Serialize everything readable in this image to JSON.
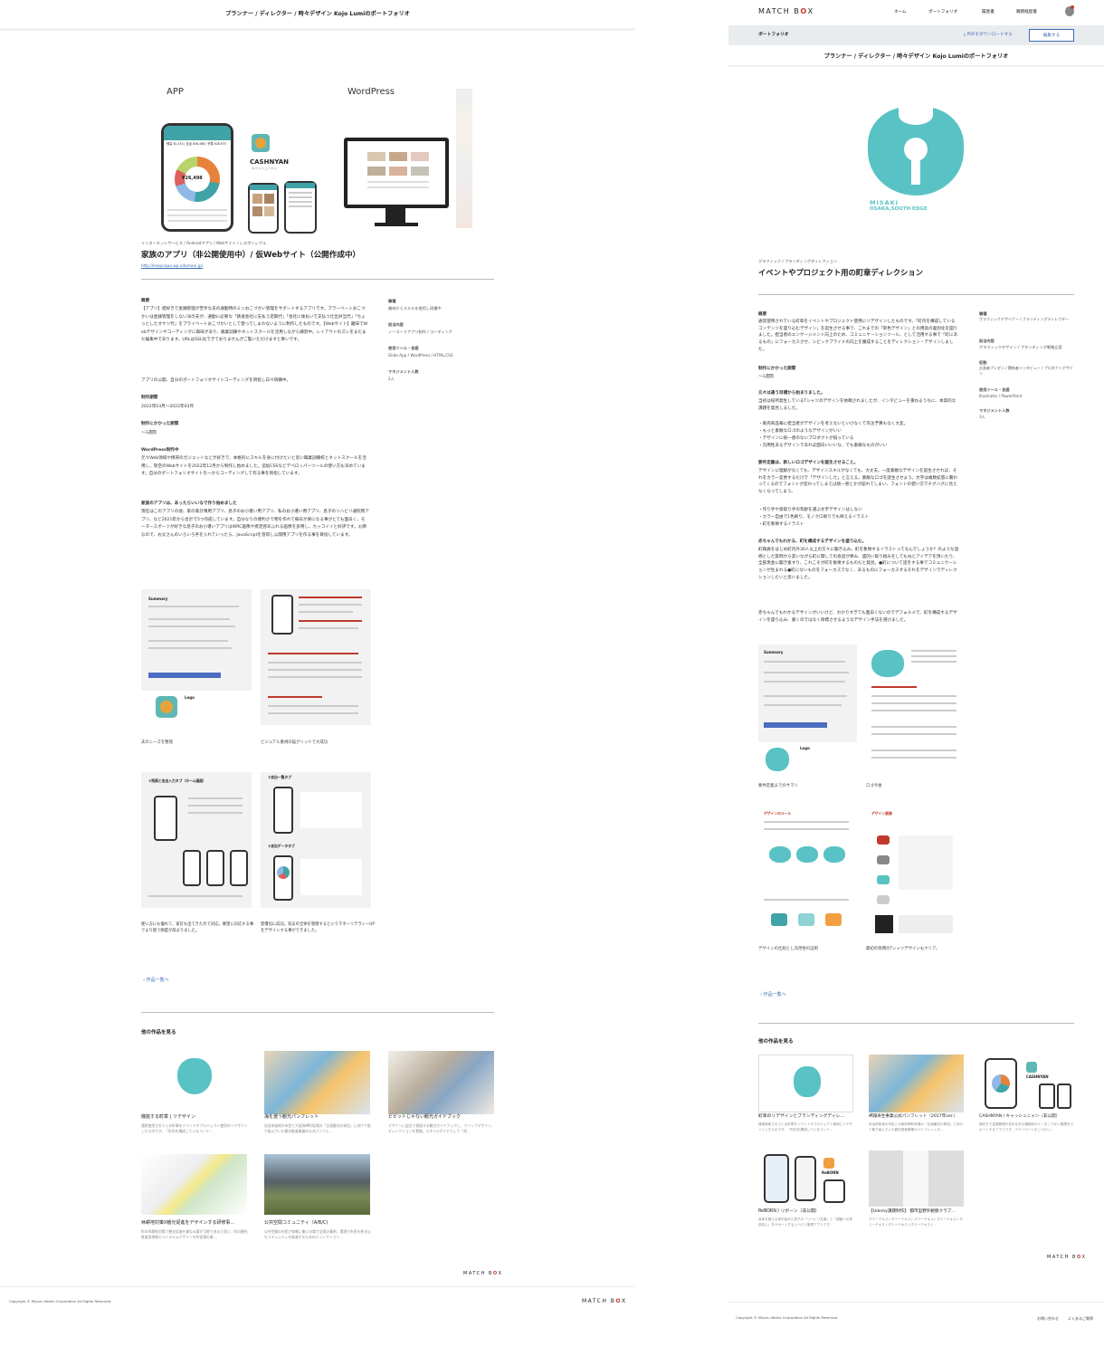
{
  "left": {
    "header_title": "プランナー / ディレクター / 時々デザイン Kojo Lumiのポートフォリオ",
    "hero": {
      "label_app": "APP",
      "label_wp": "WordPress",
      "cashnyan_name": "CASHNYAN",
      "cashnyan_kana": "キャッシュニャン",
      "phone_amount": "¥26,498",
      "phone_header": "残高 ¥2,470 / 支出 ¥26,498 / 予算 ¥28,973"
    },
    "category": "インターネットサービス / Androidアプリ / Webサイト / レスポンシブル",
    "title": "家族のアプリ（非公開使用中）/ 仮Webサイト（公開作成中）",
    "url": "http://lesipnapo.wp.xdomain.jp/",
    "summary_heading": "概要",
    "summary_body": "【アプリ】値好きで金銭管理が苦手な夫の通勤時のミニおこづかい管理をサポートするアプリです。プラーベートおこづかいは金銭管理をしない派の夫が、通勤に必要な「鉄道会社に支払う定期代」「会社に後払いで支払う仕出弁当代」「ちょっとしたオヤツ代」をプライベートおこづかいとして使ってしまわないように制作したものです。【Webサイト】趣味でWebデザインやコーディングに興味があり、職業訓練やネットスクールを活用しながら練習中。レイアウトのズレをまだまだ編集中であります。URLはSSL化できておりませんがご覧いただけますと幸いです。",
    "summary_note": "アプリの公開、自分のポートフォリオサイトコーディングを目指し日々研鑽中。",
    "period_heading": "制作期間",
    "period": "2022年03月～2022年03月",
    "time_heading": "制作にかかった期間",
    "time": "～1週間",
    "wp_heading": "WordPress制作中",
    "wp_body": "元々Web領域や携帯のガジェットなどが好きで、本格的にスキルを身に付けたいと思い職業訓練校とネットスクールを活用し、架空のWebサイトを2022年12月から制作し始めました。追加CSSなどデベロッパーツールの使い方も深めています。自分のポートフォリオサイトを一からコーディングして作る事を目指しています。",
    "family_heading": "家族のアプリは、あったらいいなで作り始めました",
    "family_body": "現在はこのアプリの他、家の家計簿用アプリ、息子のお小遣い用アプリ、私のお小遣い用アプリ、息子のリハビリ通院用アプリ、など2021年から合計で5つ作成しています。自分なりの便利さで物を作れて毎日が楽になる事がとても面白く、モータースポーツが好きな息子のお小遣いアプリはWRC画像や疾走感あふれる画像を多用し、カッコイイと好評です。ぉ節なので、お父さんのいろいろ手を入れていったら、JavaScriptを習得し公開用アプリを作る事を目指しています。",
    "side": {
      "role_h": "職種",
      "role": "趣味からスキルを使用し研鑽中",
      "work_h": "担当内容",
      "work": "ノーコードアプリ制作 / コーディング",
      "tools_h": "使用ツール・言語",
      "tools": "Glide App / WordPress / HTML,CSS",
      "people_h": "マネジメント人数",
      "people": "2人"
    },
    "thumbs": [
      {
        "caption": "夫のニーズを整理",
        "summary_title": "Summary",
        "logo_label": "Logo"
      },
      {
        "caption": "ビジュアル重視の猫グリッドで大成功"
      },
      {
        "caption": "使い方にも優れて、家計も出てきたので対応。要望に対応する事でより使う頻度が高まりました。",
        "panel_title": "①残高と支出入力タブ（ホーム画面）"
      },
      {
        "caption": "習慣化に成功。収支の全体を管理するというマネーリテラシーUPをデザインする事ができました。",
        "panel_title1": "②支出一覧タブ",
        "panel_title2": "③支出データタブ"
      }
    ],
    "back_link": "作品一覧へ",
    "others_heading": "他の作品を見る",
    "others": [
      {
        "title": "機能する町章 | リデザイン",
        "desc": "通常使用されている町章をイベントやプロジェクト使用のリデザインしたものです。「町内を構成しているコンテ…"
      },
      {
        "title": "海を渡う観光パンフレット",
        "desc": "自治体各地の市民と大阪府岬町役場の「企画観光の発信」に向けて取り組んでいた観光推進事業の公式パンフレ…"
      },
      {
        "title": "ビビットじゃない観光ガイドブック",
        "desc": "デザインに起点で直接する観光ガイドブックし、クリップデザイン、ディレクションを実施。スタイルガイドとして「改…"
      },
      {
        "title": "休耕地対策X観光促進をデザインする研修事…",
        "desc": "町の休耕地対策と観光促進を兼ねる事が可能であると思い、町の観光推進型地域エコシステムデザインを町役場の事…"
      },
      {
        "title": "公共空間コミュニティ（A/B/C)",
        "desc": "公共空間の市民が気軽に集いの場で全国の事例、環境で市民を巻き込むコミュニティを推進するためのディレクション…"
      }
    ],
    "footer_logo": "MATCH BOX",
    "copyright": "Copyright © Miyoru Works Corporation All Rights Reserved.",
    "footer_logo2": "MATCH BOX"
  },
  "right": {
    "logo": "MATCH BOX",
    "nav": [
      "ホーム",
      "ポートフォリオ",
      "履歴書",
      "職務経歴書"
    ],
    "subbar_title": "ポートフォリオ",
    "pdf_link": "PDFをダウンロードする",
    "edit_button": "編集する",
    "header_title": "プランナー / ディレクター / 時々デザイン Kojo Lumiのポートフォリオ",
    "emblem_text1": "MISAKI",
    "emblem_text2": "OSAKA,SOUTH EDGE",
    "category": "グラフィック / ブランディングディレクション",
    "title": "イベントやプロジェクト用の町章ディレクション",
    "summary_heading": "概要",
    "summary_body": "通常使用されている町章をイベントやプロジェクト使用にリデザインしたものです。「町内を構成しているコンテンツを盛り込むデザイン」を誕生させる事で、これまでの「単色デザイン」との用途の差別化を図りました。担当者のエンゲージメント向上のため、コミュニケーションツール、として活用する事で「町にあるもの」にフォーカスさせ、シビックプライドの向上を醸成することをディレクション・デザインしました。",
    "time_heading": "制作にかかった期間",
    "time": "～1週間",
    "origin_heading": "元々は違う目標から始まりました。",
    "origin_body": "当初は役所発生しているTシャツのデザインを依頼されましたが、インタビューを重ねるうちに、本質的な課題を発見しました。",
    "bullets1": [
      "・販売商品毎に担当者がデザインを考えないといけなくて作注予算もなく大変。",
      "・もっと素敵なロゴのようなデザインがいい",
      "・デザインに統一感のないプロダクトが揃っている",
      "・汎用性あるデザインであれば面白いいいな、でも素敵なものがいい"
    ],
    "req_heading": "要件定義は、新しいロゴデザインを誕生させること。",
    "req_body": "デザインに理解がなくても、デザインスキルがなくても、大丈夫。一度素敵なデザインを誕生させれば、それをカラー変更するだけで「デザインした」と言える。素敵なロゴを誕生させよう。文字は複数拡張に繋わってくるのでフォントが変わってしまえば統一感とかが崩れてしまい、フォントの使い方でチグハグに見えなくなってしまう。",
    "bullets2": [
      "・作り手や受取り手の年齢を選ぶ文字デザインはしない",
      "・カラー自由で1色刷り、モノクロ刷りでも映えるイラスト",
      "・町を象徴するイラスト"
    ],
    "kids_heading": "赤ちゃんでもわかる、町を構成するデザインを盛り込む。",
    "kids_body": "町職員をはじめ町内外30人以上の方々に聞き込み。町を象徴するイラストってなんでしょうか？のような温柄とした質問から実いながら町に関しての会話が弾み、盛的い取り組みをしてもねとアイデアを頂いたり、全部黒金に聞き素すり、これこそが町を象徴するものだと発見。●町について話をする事でコミュニケーションが生まれる●町にないものをフォーカスでなく、あるものにフォーカスするそれをデザインでディレクションしたいと思いました。",
    "kids_note": "赤ちゃんでもわかるデザインがいいけど、わかりすぎても面白くないのでデフォルメで、町を構成するデザインを盛り込み、書くのではなく目標させるようなデザイン手法を選びました。",
    "side": {
      "role_h": "職種",
      "role": "グラフィックデザイナー / ブランディングディレクター",
      "work_h": "担当内容",
      "work": "グラフィックデザイン / ブランディング戦略立案",
      "flow_h": "役割",
      "flow": "企画者プレゼン / 関係者インタビュー / プロダクトデザイン",
      "tools_h": "使用ツール・言語",
      "tools": "Illustrator / PowerPoint",
      "people_h": "マネジメント人数",
      "people": "3人"
    },
    "thumbs": [
      {
        "caption": "要件定義までのサマリ",
        "summary_title": "Summary",
        "logo_label": "Logo"
      },
      {
        "caption": "ロゴ今後"
      },
      {
        "caption": "デザインの仕組とし汎用性の証明",
        "panel_title": "デザインのルール"
      },
      {
        "caption": "最初の目標のTシャツデザインもクリア。",
        "panel_title": "デザイン展開"
      }
    ],
    "back_link": "作品一覧へ",
    "others_heading": "他の作品を見る",
    "others": [
      {
        "title": "町章のリデザインとブランディングディレ…",
        "desc": "通常使用されている町章をイベントやプロジェクト使用にリデザインしたものです。「町内を構成しているコンテ…"
      },
      {
        "title": "岬諏寿生事業公式パンフレット（2017年ver.）",
        "desc": "自治体各地の市民と大阪府岬町役場の「企画観光の発信」に向けて取り組んでいた観光推進事業のパンフレット方…"
      },
      {
        "title": "CASHNYAN / キャッシュニャン（非公開）",
        "desc": "値好きで金銭管理が苦手な夫の通勤時のミニおこづかい管理をサポートするアプリです。プラーベートおこづかい…"
      },
      {
        "title": "ReBORN / リボーン（非公開）",
        "desc": "身体を鍛える事を始めた息子の「リハビリ支援」と「運動への意欲向上」をサポートするリハビリ管理アプリです…"
      },
      {
        "title": "【Udemy課題制作】 都市型野外観察クラブ…",
        "desc": "ダミーテキストダミーテキストダミーテキストダミーテキストダミーテキストダミーテキストダミーテキスト…"
      }
    ],
    "cashnyan_label": "CASHNYAN",
    "reborn_label": "ReBORN",
    "footer_logo": "MATCH BOX",
    "copyright": "Copyright © Miyoru Works Corporation All Rights Reserved.",
    "footer_links": [
      "お問い合わせ",
      "よくあるご質問"
    ]
  },
  "colors": {
    "accent": "#3a6fb0",
    "teal": "#59c2c4",
    "brand_red": "#c0392b",
    "phone_orange": "#e8823a"
  }
}
